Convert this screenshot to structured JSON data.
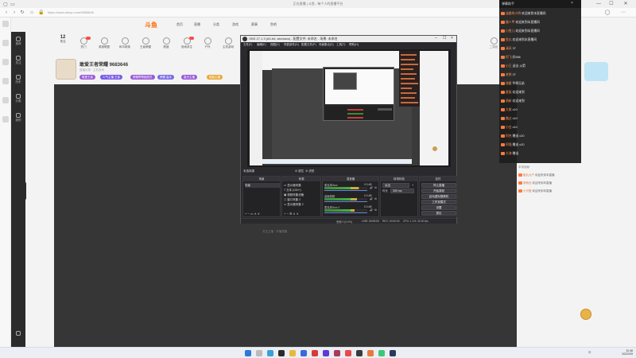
{
  "browser": {
    "title": "正在直播 | 斗鱼 - 每个人的直播平台",
    "url": "https://www.douyu.com/9683646",
    "window_controls": [
      "—",
      "☐",
      "✕"
    ]
  },
  "site": {
    "logo": "斗鱼",
    "nav": [
      "首页",
      "直播",
      "分类",
      "游戏",
      "赛事",
      "鱼吧"
    ],
    "categories": [
      {
        "label": "关注"
      },
      {
        "label": "热门"
      },
      {
        "label": "英雄联盟"
      },
      {
        "label": "和平精英"
      },
      {
        "label": "王者荣耀"
      },
      {
        "label": "颜值"
      },
      {
        "label": "绝地求生"
      },
      {
        "label": "户外"
      },
      {
        "label": "主机游戏"
      },
      {
        "label": "单机热游"
      },
      {
        "label": "一起看"
      },
      {
        "label": "二次元"
      },
      {
        "label": "更多"
      }
    ],
    "follow_count": "12"
  },
  "sidebar": {
    "items": [
      "推荐",
      "关注",
      "历史",
      "分类",
      "我的"
    ]
  },
  "streamer": {
    "name": "敢爱王者荣耀 9683646",
    "subtitle": "直播分类 · 主机游戏",
    "tags": [
      {
        "text": "敢爱王者",
        "color": "#9a5ad8"
      },
      {
        "text": "人气主播 王者",
        "color": "#7a5ae8"
      },
      {
        "text": "荣耀帮帮团成员",
        "color": "#9a5ad8"
      },
      {
        "text": "荣耀 高手",
        "color": "#7a6ae8"
      },
      {
        "text": "星光主播",
        "color": "#9a5ad8"
      },
      {
        "text": "超级主播",
        "color": "#e8a83a"
      }
    ]
  },
  "stream": {
    "below_text": "关注主播 · 开播提醒"
  },
  "chat_overlay": {
    "title": "弹幕助手",
    "rows": [
      {
        "user": "迷路的小明",
        "text": "欢迎来到本直播间"
      },
      {
        "user": "路人甲",
        "text": "欢迎来到本直播间"
      },
      {
        "user": "小鱼儿",
        "text": "欢迎来到本直播间"
      },
      {
        "user": "鱼丸",
        "text": "欢迎来到本直播间"
      },
      {
        "user": "清风",
        "text": "37"
      },
      {
        "user": "阿飞",
        "text": "好666"
      },
      {
        "user": "小王",
        "text": "送出 火箭"
      },
      {
        "user": "老铁",
        "text": "37"
      },
      {
        "user": "流星",
        "text": "牛啊兄弟"
      },
      {
        "user": "星辰",
        "text": "欢迎来到"
      },
      {
        "user": "萌新",
        "text": "欢迎来到"
      },
      {
        "user": "大佬",
        "text": "x10"
      },
      {
        "user": "路过",
        "text": "x10"
      },
      {
        "user": "小白",
        "text": "x10"
      },
      {
        "user": "阿杰",
        "text": "赠送 x20"
      },
      {
        "user": "阿强",
        "text": "赠送 x20"
      },
      {
        "user": "大海",
        "text": "赠送"
      }
    ]
  },
  "chat_lower": {
    "label": "本场贡献",
    "rows": [
      {
        "user": "鱼丸大户",
        "text": "欢迎来到本直播"
      },
      {
        "user": "老粉丝",
        "text": "欢迎来到本直播"
      },
      {
        "user": "小可爱",
        "text": "欢迎来到本直播"
      }
    ]
  },
  "obs": {
    "title": "OBS 27.1.3 (64-bit, windows) - 配置文件: 未命名 - 场景: 未命名",
    "menu": [
      "文件(F)",
      "编辑(E)",
      "视图(V)",
      "停靠部件(D)",
      "配置文件(P)",
      "场景集合(S)",
      "工具(T)",
      "帮助(H)"
    ],
    "no_source": "未选择源",
    "top_controls": [
      "属性",
      "滤镜"
    ],
    "docks": {
      "scenes": {
        "title": "场景",
        "items": [
          "场景"
        ]
      },
      "sources": {
        "title": "来源",
        "items": [
          "显示器采集",
          "文本 (GDI+)",
          "视频采集设备",
          "窗口采集 2",
          "显示器采集 2"
        ]
      },
      "mixer": {
        "title": "混音器",
        "channels": [
          {
            "name": "麦克风/Aux",
            "db": "0.0 dB",
            "level": 0.82
          },
          {
            "name": "桌面音频",
            "db": "0.0 dB",
            "level": 0.76
          },
          {
            "name": "麦克风/Aux 2",
            "db": "0.0 dB",
            "level": 0.7
          }
        ]
      },
      "transitions": {
        "title": "转场特效",
        "type": "淡出",
        "duration_label": "时长",
        "duration": "300 ms"
      },
      "controls": {
        "title": "控件",
        "buttons": [
          "停止直播",
          "开始录制",
          "启动虚拟摄像机",
          "工作室模式",
          "设置",
          "退出"
        ]
      }
    },
    "status": {
      "drop": "丢帧 0 (0.0%)",
      "live": "LIVE: 00:00:00",
      "rec": "REC: 00:00:00",
      "cpu": "CPU: 1.1%, 30.00 fps"
    }
  },
  "taskbar": {
    "time": "10:48",
    "date": "2022/3/9",
    "tray": "中"
  }
}
